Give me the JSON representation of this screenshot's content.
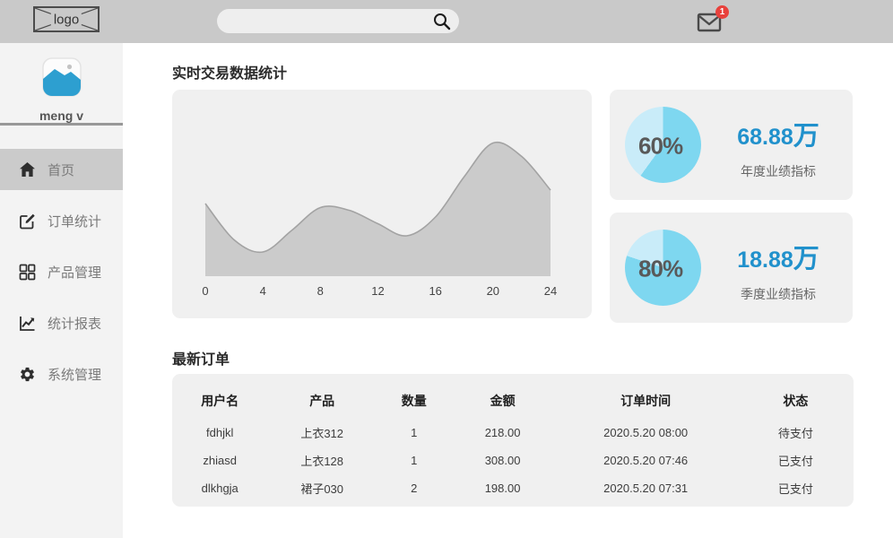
{
  "topbar": {
    "logo_text": "logo",
    "search_value": "",
    "mail_badge": "1"
  },
  "sidebar": {
    "username": "meng v",
    "items": [
      {
        "id": "home",
        "label": "首页",
        "active": true
      },
      {
        "id": "order-stats",
        "label": "订单统计",
        "active": false
      },
      {
        "id": "product-management",
        "label": "产品管理",
        "active": false
      },
      {
        "id": "statistics-report",
        "label": "统计报表",
        "active": false
      },
      {
        "id": "system-management",
        "label": "系统管理",
        "active": false
      }
    ]
  },
  "main": {
    "section1_title": "实时交易数据统计",
    "section2_title": "最新订单",
    "stat_cards": [
      {
        "percent": "60%",
        "value_num": "68.88",
        "value_unit": "万",
        "caption": "年度业绩指标"
      },
      {
        "percent": "80%",
        "value_num": "18.88",
        "value_unit": "万",
        "caption": "季度业绩指标"
      }
    ],
    "orders_table": {
      "columns": [
        "用户名",
        "产品",
        "数量",
        "金额",
        "订单时间",
        "状态"
      ],
      "rows": [
        [
          "fdhjkl",
          "上衣312",
          "1",
          "218.00",
          "2020.5.20 08:00",
          "待支付"
        ],
        [
          "zhiasd",
          "上衣128",
          "1",
          "308.00",
          "2020.5.20 07:46",
          "已支付"
        ],
        [
          "dlkhgja",
          "裙子030",
          "2",
          "198.00",
          "2020.5.20 07:31",
          "已支付"
        ]
      ]
    }
  },
  "colors": {
    "topbar_gray": "#c9c9c9",
    "panel_gray": "#f0f0f0",
    "accent_blue": "#2191cc",
    "badge_red": "#e8413c",
    "avatar_blue": "#2d9fd0"
  },
  "chart_data": [
    {
      "type": "area",
      "title": "实时交易数据统计",
      "x": [
        0,
        2,
        4,
        6,
        8,
        10,
        12,
        14,
        16,
        18,
        20,
        22,
        24
      ],
      "values": [
        54,
        27,
        18,
        34,
        51,
        49,
        39,
        30,
        44,
        74,
        99,
        89,
        64
      ],
      "xticks": [
        0,
        4,
        8,
        12,
        16,
        20,
        24
      ],
      "xlabel": "",
      "ylabel": "",
      "ylim": [
        0,
        100
      ],
      "grid": false,
      "fill_color": "#cbcbcb",
      "line_color": "#a3a3a3"
    },
    {
      "type": "pie",
      "center_label": "60%",
      "slices": [
        {
          "name": "achieved",
          "value": 60,
          "color": "#7ed7f0"
        },
        {
          "name": "remaining",
          "value": 40,
          "color": "#c9ecf9"
        }
      ],
      "value_text": "68.88万",
      "caption": "年度业绩指标"
    },
    {
      "type": "pie",
      "center_label": "80%",
      "slices": [
        {
          "name": "achieved",
          "value": 80,
          "color": "#7ed7f0"
        },
        {
          "name": "remaining",
          "value": 20,
          "color": "#c9ecf9"
        }
      ],
      "value_text": "18.88万",
      "caption": "季度业绩指标"
    }
  ]
}
